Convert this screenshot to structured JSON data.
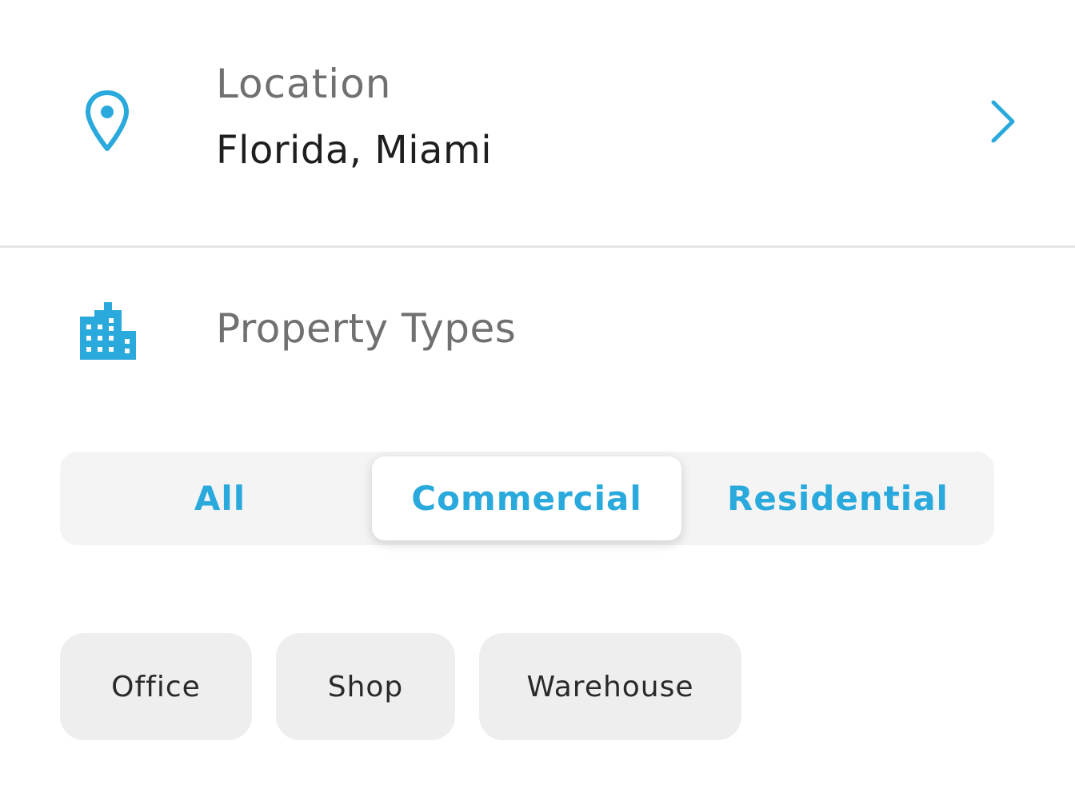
{
  "location": {
    "label": "Location",
    "value": "Florida, Miami",
    "icon": "map-pin-icon",
    "action_icon": "chevron-right-icon"
  },
  "property_types": {
    "label": "Property Types",
    "icon": "building-icon",
    "segments": [
      "All",
      "Commercial",
      "Residential"
    ],
    "selected_segment": "Commercial",
    "chips": [
      "Office",
      "Shop",
      "Warehouse"
    ]
  },
  "colors": {
    "accent": "#29a9dc",
    "label_gray": "#707070",
    "value_text": "#1e1e1e",
    "chip_bg": "#eeeeee",
    "segmented_bg": "#f4f4f4"
  }
}
